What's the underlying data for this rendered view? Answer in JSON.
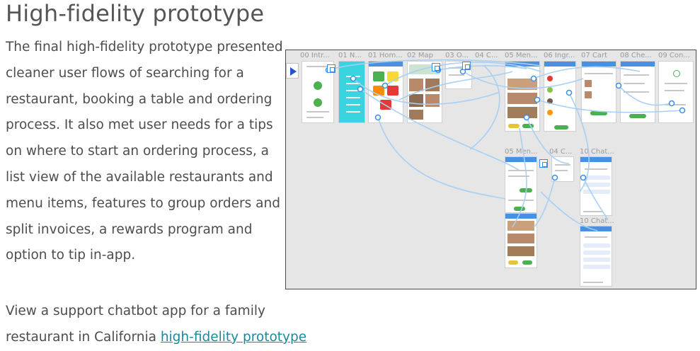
{
  "page": {
    "title": "High-fidelity prototype",
    "paragraph1": "The final high-fidelity prototype presented cleaner user flows of searching for a restaurant, booking a table and ordering process. It also met user needs for a tips on where to start an ordering process, a list view of the available restaurants and menu items, features to group orders and split invoices, a rewards program and option to tip in-app.",
    "paragraph2_before_link": "View a support chatbot app for a family restaurant in California ",
    "link_text": "high-fidelity prototype"
  },
  "prototype": {
    "frame_labels": {
      "intro": "00 Intr...",
      "nav": "01 N...",
      "home": "01 Hom...",
      "map": "02 Map",
      "options": "03 O...",
      "contact": "04 C...",
      "menu": "05 Men...",
      "ingredients": "06 Ingr...",
      "cart": "07 Cart",
      "checkout": "08 Che...",
      "confirm": "09 Con...",
      "menu2": "05 Men...",
      "contact2": "04 C...",
      "chat1": "10 Chat...",
      "chat2": "10 Chat..."
    },
    "colors": {
      "canvas": "#e6e6e6",
      "connector": "#a8d0f5",
      "accent_blue": "#4a90e2",
      "nav_cyan": "#3ad3e0",
      "button_green": "#4caf50",
      "button_yellow": "#e6c532",
      "tile_red": "#e53935",
      "tile_orange": "#fb8c00",
      "tile_yellow": "#fdd835"
    },
    "icons": [
      "play-icon",
      "phone-icon",
      "chat-icon",
      "connector-node-icon"
    ]
  }
}
